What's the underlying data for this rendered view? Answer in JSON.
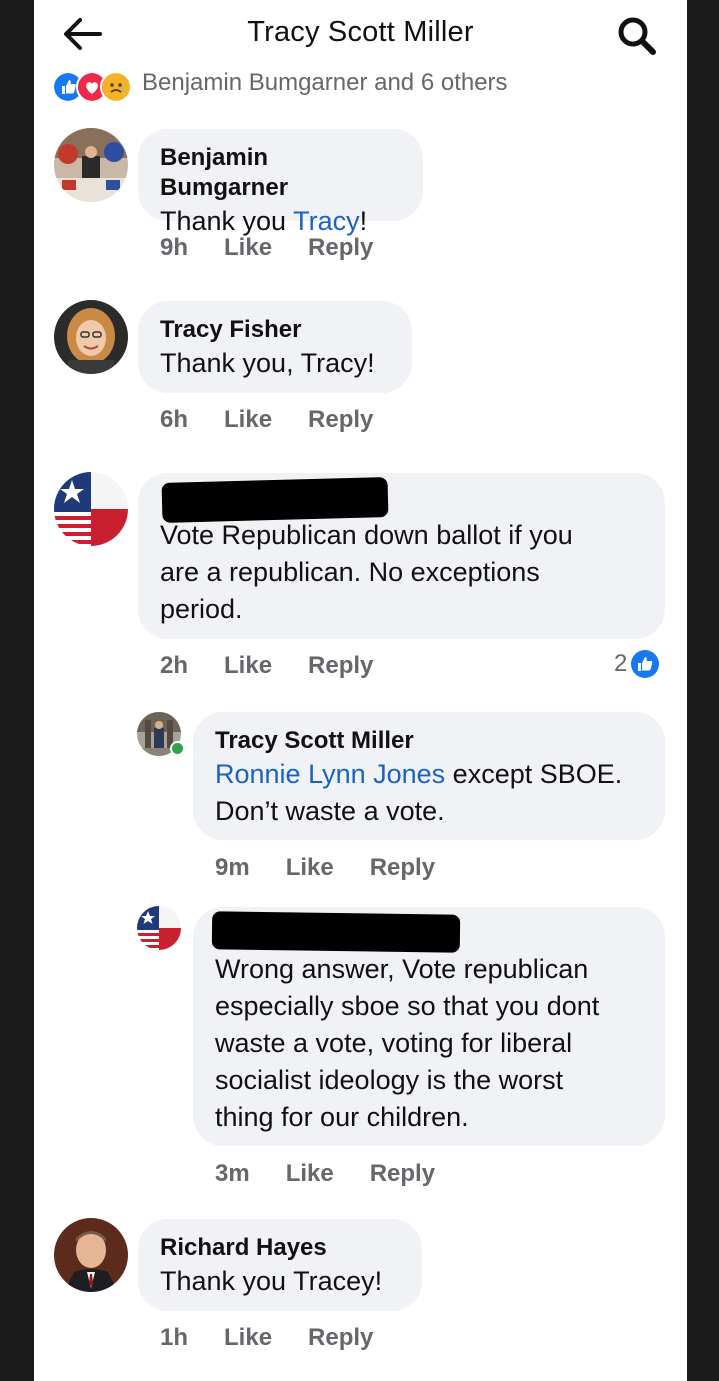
{
  "header": {
    "title": "Tracy Scott Miller"
  },
  "reactions": {
    "summary": "Benjamin Bumgarner and 6 others",
    "icons": [
      "like-reaction-icon",
      "love-reaction-icon",
      "care-reaction-icon"
    ]
  },
  "comments": [
    {
      "name": "Benjamin Bumgarner",
      "text_before": "Thank you ",
      "mention": "Tracy",
      "text_after": "!",
      "time": "9h",
      "like": "Like",
      "reply": "Reply"
    },
    {
      "name": "Tracy Fisher",
      "text": "Thank you, Tracy!",
      "time": "6h",
      "like": "Like",
      "reply": "Reply"
    },
    {
      "name": "",
      "lines": [
        "Vote Republican down ballot if you",
        "are a republican. No exceptions",
        "period."
      ],
      "time": "2h",
      "like": "Like",
      "reply": "Reply",
      "like_count": "2"
    }
  ],
  "replies": [
    {
      "name": "Tracy Scott Miller",
      "mention": "Ronnie Lynn Jones",
      "line1_rest": " except SBOE.",
      "line2": "Don’t waste a vote.",
      "time": "9m",
      "like": "Like",
      "reply": "Reply"
    },
    {
      "name": "",
      "lines": [
        "Wrong answer, Vote republican",
        "especially sboe so that you dont",
        "waste a vote, voting for liberal",
        "socialist ideology is the worst",
        "thing for our children."
      ],
      "time": "3m",
      "like": "Like",
      "reply": "Reply"
    }
  ],
  "last_comment": {
    "name": "Richard Hayes",
    "text": "Thank you Tracey!",
    "time": "1h",
    "like": "Like",
    "reply": "Reply"
  },
  "colors": {
    "bubble": "#f0f2f5",
    "mention": "#1a62c7",
    "meta": "#65676b",
    "like_blue": "#1877f2"
  }
}
